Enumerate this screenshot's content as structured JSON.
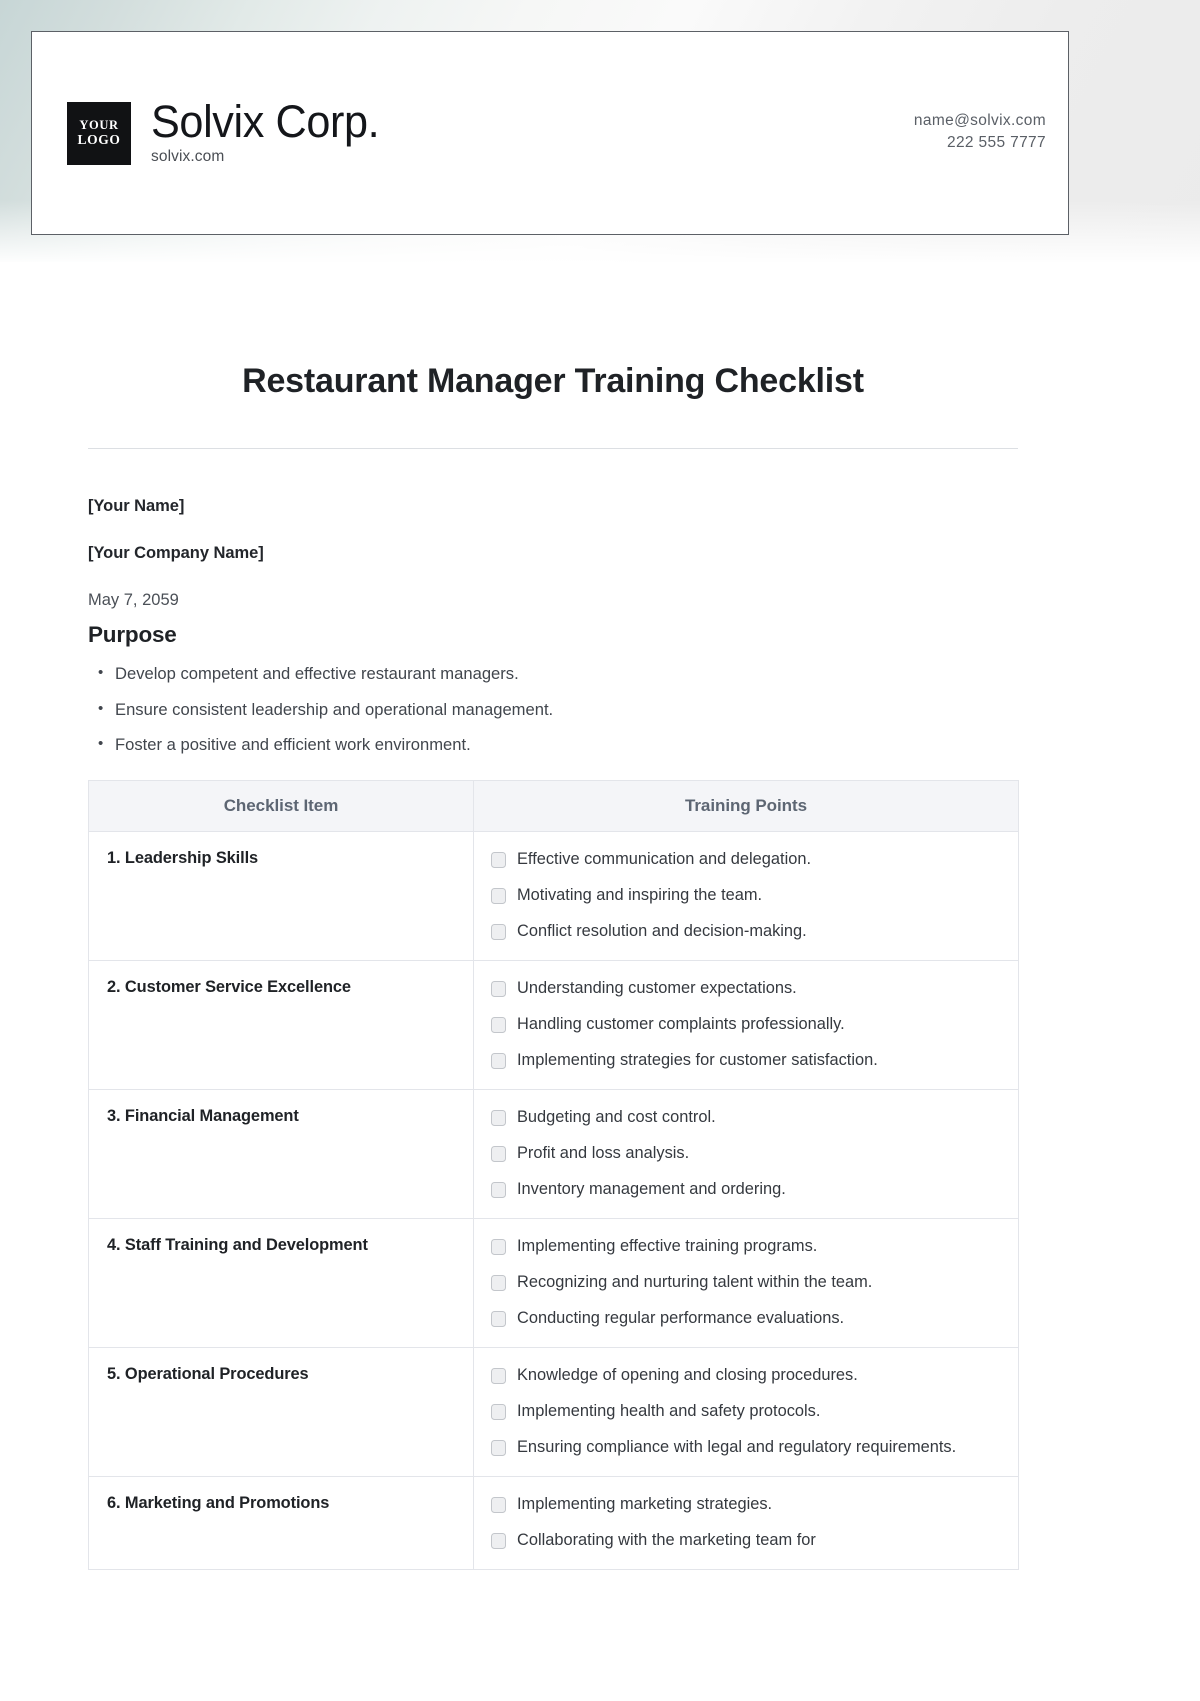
{
  "letterhead": {
    "logo": {
      "line1": "YOUR",
      "line2": "LOGO"
    },
    "company_name": "Solvix Corp.",
    "website": "solvix.com",
    "email": "name@solvix.com",
    "phone": "222 555 7777"
  },
  "document": {
    "title": "Restaurant Manager Training Checklist",
    "author_placeholder": "[Your Name]",
    "company_placeholder": "[Your Company Name]",
    "date": "May 7, 2059",
    "purpose_heading": "Purpose",
    "purpose_bullets": [
      "Develop competent and effective restaurant managers.",
      "Ensure consistent leadership and operational management.",
      "Foster a positive and efficient work environment."
    ]
  },
  "table": {
    "headers": [
      "Checklist Item",
      "Training Points"
    ],
    "rows": [
      {
        "item": "1. Leadership Skills",
        "points": [
          "Effective communication and delegation.",
          "Motivating and inspiring the team.",
          "Conflict resolution and decision-making."
        ]
      },
      {
        "item": "2. Customer Service Excellence",
        "points": [
          "Understanding customer expectations.",
          "Handling customer complaints professionally.",
          "Implementing strategies for customer satisfaction."
        ]
      },
      {
        "item": "3. Financial Management",
        "points": [
          "Budgeting and cost control.",
          "Profit and loss analysis.",
          "Inventory management and ordering."
        ]
      },
      {
        "item": "4. Staff Training and Development",
        "points": [
          "Implementing effective training programs.",
          "Recognizing and nurturing talent within the team.",
          "Conducting regular performance evaluations."
        ]
      },
      {
        "item": "5. Operational Procedures",
        "points": [
          "Knowledge of opening and closing procedures.",
          "Implementing health and safety protocols.",
          "Ensuring compliance with legal and regulatory requirements."
        ]
      },
      {
        "item": "6. Marketing and Promotions",
        "points": [
          "Implementing marketing strategies.",
          "Collaborating with the marketing team for"
        ]
      }
    ]
  },
  "colors": {
    "logo_background": "#111214",
    "letterhead_border": "#5c6066",
    "table_header_background": "#f4f5f8",
    "table_header_text": "#5d6673",
    "table_border": "#e3e5ea",
    "checkbox_fill": "#eeeff1",
    "checkbox_border": "#c3c6cb",
    "body_text": "#35393f"
  }
}
